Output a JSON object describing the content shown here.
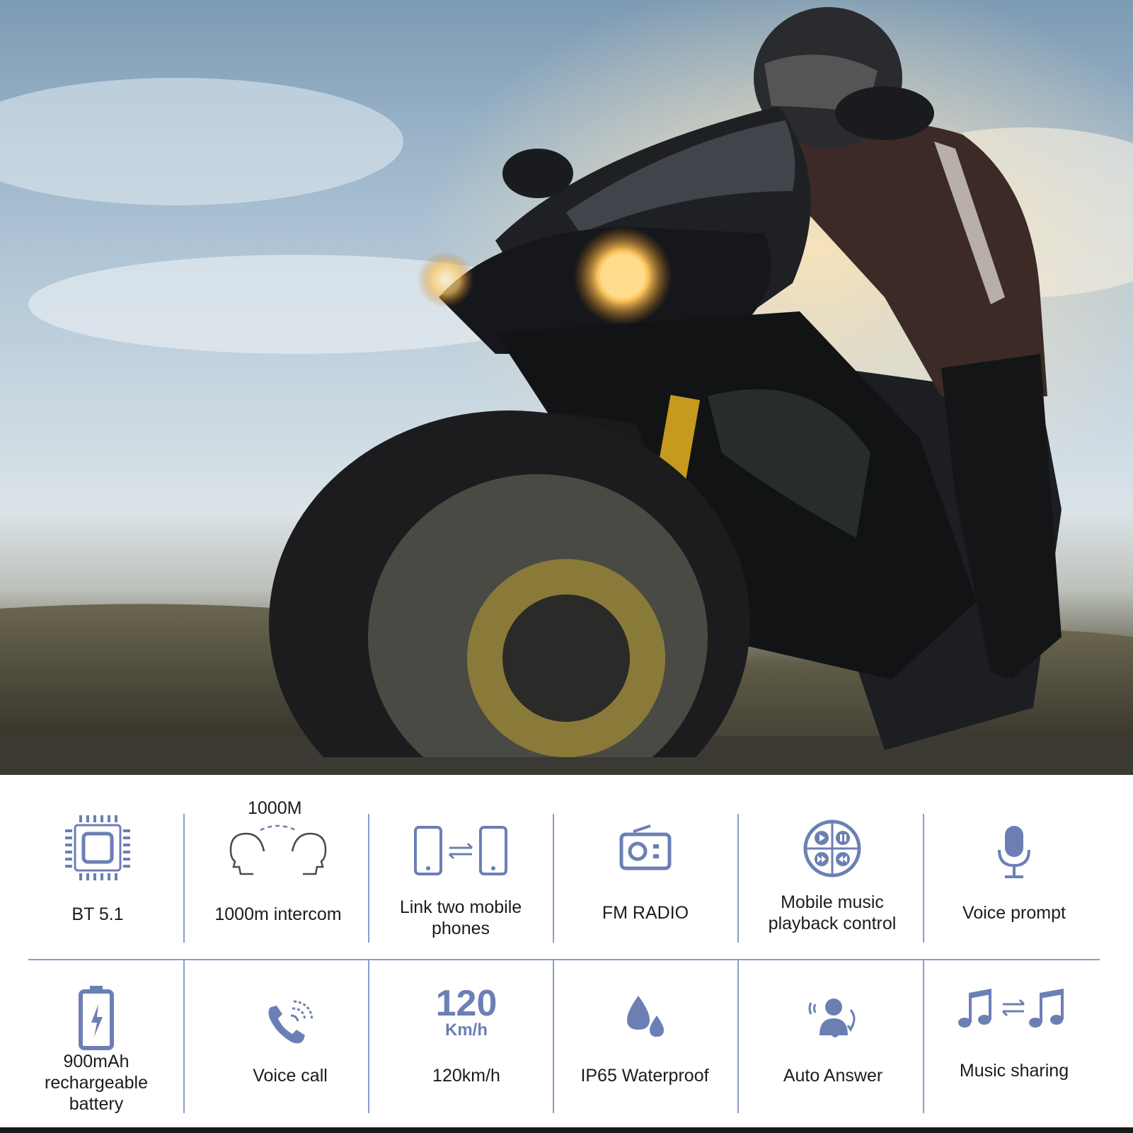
{
  "features_row1": [
    {
      "icon": "chip-icon",
      "label": "BT 5.1"
    },
    {
      "icon": "intercom-heads-icon",
      "label": "1000m intercom",
      "note": "1000M"
    },
    {
      "icon": "two-phones-icon",
      "label": "Link two mobile\nphones"
    },
    {
      "icon": "radio-icon",
      "label": "FM RADIO"
    },
    {
      "icon": "music-controls-icon",
      "label": "Mobile music\nplayback control"
    },
    {
      "icon": "microphone-icon",
      "label": "Voice prompt"
    }
  ],
  "features_row2": [
    {
      "icon": "battery-icon",
      "label": "900mAh\nrechargeable\nbattery"
    },
    {
      "icon": "phone-call-icon",
      "label": "Voice call"
    },
    {
      "icon": "speed-icon",
      "label": "120km/h",
      "speed_number": "120",
      "speed_unit": "Km/h"
    },
    {
      "icon": "water-drops-icon",
      "label": "IP65 Waterproof"
    },
    {
      "icon": "auto-answer-icon",
      "label": "Auto Answer"
    },
    {
      "icon": "music-share-icon",
      "label": "Music sharing"
    }
  ],
  "colors": {
    "icon": "#6c7fb5",
    "divider": "#8a9ccc",
    "text": "#1c1c1c"
  }
}
